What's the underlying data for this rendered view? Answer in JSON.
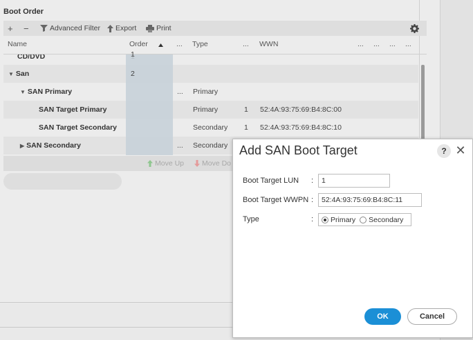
{
  "section": {
    "title": "Boot Order"
  },
  "toolbar": {
    "add_symbol": "+",
    "remove_symbol": "−",
    "advanced_filter": "Advanced Filter",
    "export": "Export",
    "print": "Print",
    "settings_icon": "gear-icon"
  },
  "table": {
    "columns": {
      "name": "Name",
      "order": "Order",
      "ellipsis": "...",
      "type": "Type",
      "wwn": "WWN"
    },
    "rows": [
      {
        "name": "CD/DVD",
        "order": "1",
        "type": "",
        "lun": "",
        "wwn": ""
      },
      {
        "name": "San",
        "order": "2",
        "type": "",
        "lun": "",
        "wwn": ""
      },
      {
        "name": "SAN Primary",
        "order": "",
        "type": "Primary",
        "lun": "",
        "wwn": ""
      },
      {
        "name": "SAN Target Primary",
        "order": "",
        "type": "Primary",
        "lun": "1",
        "wwn": "52:4A:93:75:69:B4:8C:00"
      },
      {
        "name": "SAN Target Secondary",
        "order": "",
        "type": "Secondary",
        "lun": "1",
        "wwn": "52:4A:93:75:69:B4:8C:10"
      },
      {
        "name": "SAN Secondary",
        "order": "",
        "type": "Secondary",
        "lun": "",
        "wwn": ""
      }
    ],
    "move_up": "Move Up",
    "move_down": "Move Do"
  },
  "dialog": {
    "title": "Add SAN Boot Target",
    "help": "?",
    "close": "✕",
    "fields": {
      "lun_label": "Boot Target LUN",
      "lun_value": "1",
      "wwpn_label": "Boot Target WWPN",
      "wwpn_value": "52:4A:93:75:69:B4:8C:11",
      "type_label": "Type",
      "colon": ":",
      "type_options": [
        "Primary",
        "Secondary"
      ],
      "type_selected": "Primary"
    },
    "ok": "OK",
    "cancel": "Cancel"
  },
  "colors": {
    "accent": "#1b8fd6",
    "order_column": "#c5d0d8",
    "row_shade": "#e2e2e2"
  }
}
